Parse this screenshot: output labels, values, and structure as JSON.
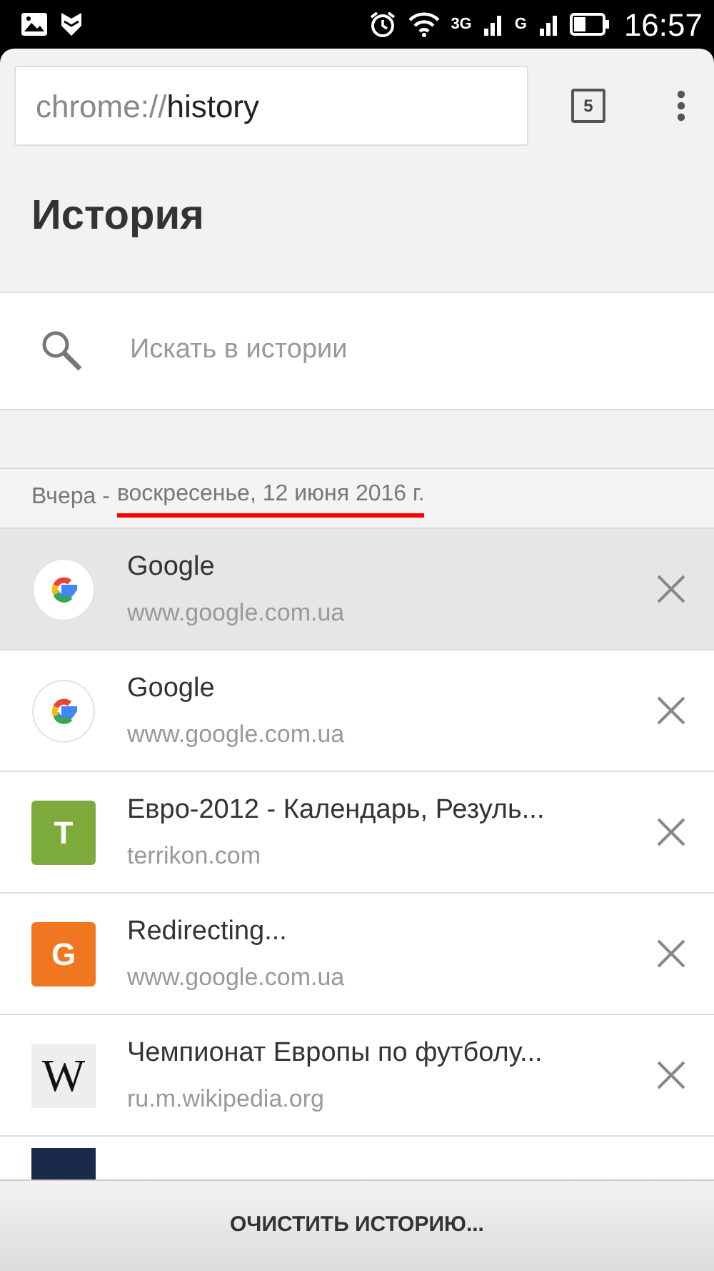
{
  "status_bar": {
    "network_1": "3G",
    "network_2": "G",
    "time": "16:57"
  },
  "toolbar": {
    "url_scheme": "chrome://",
    "url_path": "history",
    "tab_count": "5"
  },
  "page_title": "История",
  "search": {
    "placeholder": "Искать в истории"
  },
  "date_header": {
    "label": "Вчера -",
    "date": "воскресенье, 12 июня 2016 г.",
    "underlined": true
  },
  "entries": [
    {
      "kind": "google",
      "title": "Google",
      "url": "www.google.com.ua",
      "selected": true
    },
    {
      "kind": "google",
      "title": "Google",
      "url": "www.google.com.ua",
      "selected": false
    },
    {
      "kind": "letter",
      "letter": "T",
      "color": "#7cab3c",
      "title": "Евро-2012 - Календарь, Резуль...",
      "url": "terrikon.com",
      "selected": false
    },
    {
      "kind": "letter",
      "letter": "G",
      "color": "#f0771f",
      "title": "Redirecting...",
      "url": "www.google.com.ua",
      "selected": false
    },
    {
      "kind": "wiki",
      "letter": "W",
      "title": "Чемпионат Европы по футболу...",
      "url": "ru.m.wikipedia.org",
      "selected": false
    },
    {
      "kind": "partial",
      "color": "#1a2a4a",
      "selected": false
    }
  ],
  "clear_button": "ОЧИСТИТЬ ИСТОРИЮ..."
}
